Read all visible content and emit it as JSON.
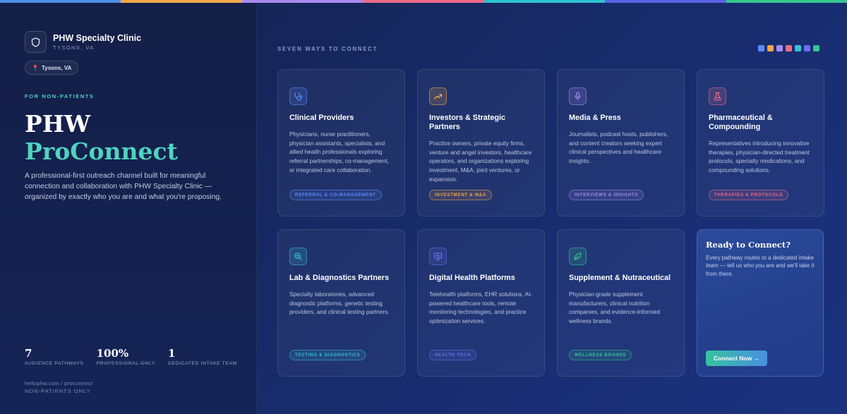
{
  "topbar_colors": [
    "#4f8fe8",
    "#f4a94a",
    "#a98bf0",
    "#ee6a87",
    "#2fc3d0",
    "#5b62e6",
    "#35c88e"
  ],
  "brand": {
    "name": "PHW Specialty Clinic",
    "location": "TYSONS, VA",
    "location_pill": "Tysons, VA"
  },
  "hero": {
    "eyebrow": "FOR NON-PATIENTS",
    "line1": "PHW",
    "line2": "ProConnect",
    "description": "A professional-first outreach channel built for meaningful connection and collaboration with PHW Specialty Clinic — organized by exactly who you are and what you're proposing."
  },
  "stats": [
    {
      "value": "7",
      "label": "AUDIENCE PATHWAYS"
    },
    {
      "value": "100%",
      "label": "PROFESSIONAL-ONLY"
    },
    {
      "value": "1",
      "label": "DEDICATED INTAKE TEAM"
    }
  ],
  "footer": {
    "url": "hellophw.com / proconnect",
    "note": "NON-PATIENTS ONLY"
  },
  "section_title": "SEVEN WAYS TO CONNECT",
  "cards": [
    {
      "icon": "stethoscope-icon",
      "accent": "#5b8cff",
      "title": "Clinical Providers",
      "body": "Physicians, nurse practitioners, physician assistants, specialists, and allied health professionals exploring referral partnerships, co-management, or integrated care collaboration.",
      "tag": "REFERRAL & CO-MANAGEMENT"
    },
    {
      "icon": "trending-up-icon",
      "accent": "#f0a54a",
      "title": "Investors & Strategic Partners",
      "body": "Practice owners, private equity firms, venture and angel investors, healthcare operators, and organizations exploring investment, M&A, joint ventures, or expansion.",
      "tag": "INVESTMENT & M&A"
    },
    {
      "icon": "microphone-icon",
      "accent": "#a48bf2",
      "title": "Media & Press",
      "body": "Journalists, podcast hosts, publishers, and content creators seeking expert clinical perspectives and healthcare insights.",
      "tag": "INTERVIEWS & INSIGHTS"
    },
    {
      "icon": "flask-icon",
      "accent": "#ec6a8c",
      "title": "Pharmaceutical & Compounding",
      "body": "Representatives introducing innovative therapies, physician-directed treatment protocols, specialty medications, and compounding solutions.",
      "tag": "THERAPIES & PROTOCOLS"
    },
    {
      "icon": "magnifier-icon",
      "accent": "#35c2d2",
      "title": "Lab & Diagnostics Partners",
      "body": "Specialty laboratories, advanced diagnostic platforms, genetic testing providers, and clinical testing partners.",
      "tag": "TESTING & DIAGNOSTICS"
    },
    {
      "icon": "monitor-icon",
      "accent": "#6a6ef0",
      "title": "Digital Health Platforms",
      "body": "Telehealth platforms, EHR solutions, AI-powered healthcare tools, remote monitoring technologies, and practice optimization services.",
      "tag": "HEALTH TECH"
    },
    {
      "icon": "leaf-icon",
      "accent": "#34c690",
      "title": "Supplement & Nutraceutical",
      "body": "Physician-grade supplement manufacturers, clinical nutrition companies, and evidence-informed wellness brands.",
      "tag": "WELLNESS BRANDS"
    }
  ],
  "cta": {
    "title": "Ready to Connect?",
    "body": "Every pathway routes to a dedicated intake team — tell us who you are and we'll take it from there.",
    "button": "Connect Now →"
  }
}
